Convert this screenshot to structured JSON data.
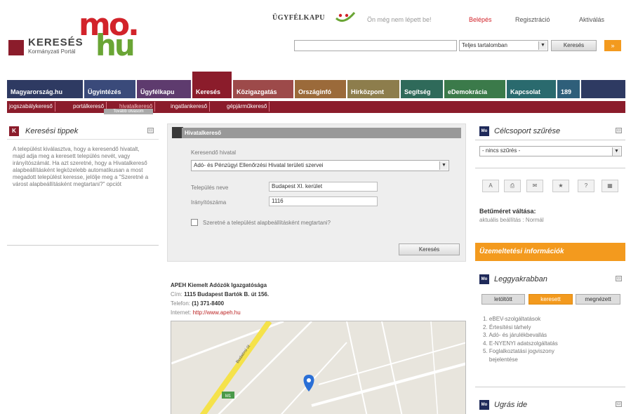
{
  "header": {
    "logo_title": "KERESÉS",
    "logo_sub": "Kormányzati Portál",
    "logo_mo": "mo.",
    "logo_hu": "hu",
    "ugyfelkapu": "ÜGYFÉLKAPU",
    "not_logged": "Ön még nem lépett be!",
    "login": "Belépés",
    "register": "Regisztráció",
    "activate": "Aktiválás",
    "search_scope": "Teljes tartalomban",
    "search_button": "Keresés",
    "go": "»"
  },
  "colors": {
    "brand": "#8b1c2b",
    "accent": "#f39a1e",
    "nav_dark": "#2e3a62"
  },
  "nav": {
    "tabs": [
      {
        "label": "Magyarország.hu"
      },
      {
        "label": "Ügyintézés"
      },
      {
        "label": "Ügyfélkapu"
      },
      {
        "label": "Keresés"
      },
      {
        "label": "Közigazgatás"
      },
      {
        "label": "Országinfó"
      },
      {
        "label": "Hírközpont"
      },
      {
        "label": "Segítség"
      },
      {
        "label": "eDemokrácia"
      },
      {
        "label": "Kapcsolat"
      },
      {
        "label": "189"
      }
    ],
    "sub": [
      "jogszabálykereső",
      "portálkereső",
      "hivatalkereső",
      "ingatlankereső",
      "gépjárműkereső"
    ]
  },
  "tips": {
    "icon": "K",
    "title": "Keresési tippek",
    "text": "A települést kiválasztva, hogy a keresendő hivatalt, majd adja meg a keresett település nevét, vagy irányítószámát. Ha azt szeretné, hogy a Hivatalkereső alapbeállításként legközelebb automatikusan a most megadott települést keresse, jelölje meg a \"Szeretné a várost alapbeállításként megtartani?\" opciót",
    "more": "Tovább olvasom"
  },
  "form": {
    "title": "Hivatalkereső",
    "office_label": "Keresendő hivatal",
    "office_value": "Adó- és Pénzügyi Ellenőrzési Hivatal területi szervei",
    "city_label": "Település neve",
    "city_value": "Budapest XI. kerület",
    "zip_label": "Irányítószáma",
    "zip_value": "1116",
    "default_label": "Szeretné a települést alapbeállításként megtartani?",
    "submit": "Keresés"
  },
  "result": {
    "name": "APEH Kiemelt Adózók Igazgatósága",
    "addr_label": "Cím:",
    "addr": "1115 Budapest Bartók B. út 156.",
    "phone_label": "Telefon:",
    "phone": "(1) 371-8400",
    "web_label": "Internet:",
    "web": "http://www.apeh.hu"
  },
  "map": {
    "road_label": "Budaörsi út",
    "road_badge": "M1"
  },
  "right": {
    "target_icon": "Mo",
    "target_title": "Célcsoport szűrése",
    "target_value": "- nincs szűrés -",
    "view_title": "Betűméret váltása:",
    "view_current": "aktuális beállítás : Normál",
    "ops_info": "Üzemeltetési információk",
    "popular_title": "Leggyakrabban",
    "tabs": [
      "letöltött",
      "keresett",
      "megnézett"
    ],
    "list": [
      "eBEV-szolgáltatások",
      "Értesítési tárhely",
      "Adó- és járulékbevallás",
      "E-NYENYI adatszolgáltatás",
      "Foglalkoztatási jogviszony",
      "bejelentése"
    ],
    "goto_title": "Ugrás ide"
  }
}
